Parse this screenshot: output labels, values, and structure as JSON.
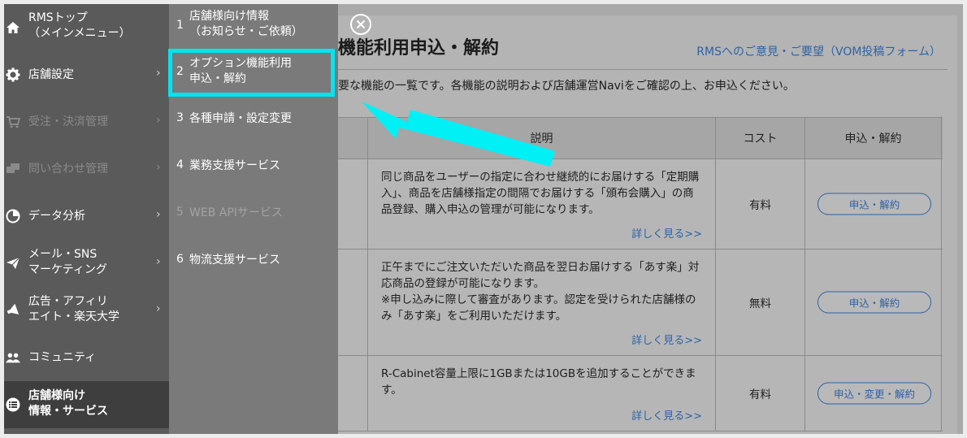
{
  "main": {
    "title": "機能利用申込・解約",
    "feedback_link": "RMSへのご意見・ご要望（VOM投稿フォーム）",
    "intro": "要な機能の一覧です。各機能の説明および店舗運営Naviをご確認の上、お申込ください。",
    "table": {
      "headers": {
        "desc": "説明",
        "cost": "コスト",
        "action": "申込・解約"
      },
      "rows": [
        {
          "desc": "同じ商品をユーザーの指定に合わせ継続的にお届けする「定期購入」、商品を店舗様指定の間隔でお届けする「頒布会購入」の商品登録、購入申込の管理が可能になります。",
          "more": "詳しく見る>>",
          "cost": "有料",
          "action": "申込・解約"
        },
        {
          "desc": "正午までにご注文いただいた商品を翌日お届けする「あす楽」対応商品の登録が可能になります。\n※申し込みに際して審査があります。認定を受けられた店舗様のみ「あす楽」をご利用いただけます。",
          "more": "詳しく見る>>",
          "cost": "無料",
          "action": "申込・解約"
        },
        {
          "desc": "R-Cabinet容量上限に1GBまたは10GBを追加することができます。",
          "more": "詳しく見る>>",
          "cost": "有料",
          "action": "申込・変更・解約"
        }
      ]
    }
  },
  "sidebar": {
    "items": [
      {
        "label": "RMSトップ\n（メインメニュー）",
        "icon": "home-icon"
      },
      {
        "label": "店舗設定",
        "icon": "gear-icon"
      },
      {
        "label": "受注・決済管理",
        "icon": "cart-icon"
      },
      {
        "label": "問い合わせ管理",
        "icon": "chat-icon"
      },
      {
        "label": "データ分析",
        "icon": "pie-chart-icon"
      },
      {
        "label": "メール・SNS\nマーケティング",
        "icon": "paper-plane-icon"
      },
      {
        "label": "広告・アフィリ\nエイト・楽天大学",
        "icon": "megaphone-icon"
      },
      {
        "label": "コミュニティ",
        "icon": "people-icon"
      },
      {
        "label": "店舗様向け\n情報・サービス",
        "icon": "list-icon"
      }
    ]
  },
  "submenu": {
    "items": [
      {
        "num": "1",
        "label": "店舗様向け情報\n（お知らせ・ご依頼）"
      },
      {
        "num": "2",
        "label": "オプション機能利用\n申込・解約"
      },
      {
        "num": "3",
        "label": "各種申請・設定変更"
      },
      {
        "num": "4",
        "label": "業務支援サービス"
      },
      {
        "num": "5",
        "label": "WEB APIサービス"
      },
      {
        "num": "6",
        "label": "物流支援サービス"
      }
    ]
  },
  "colors": {
    "highlight": "#00e4ef",
    "link": "#2e63a6"
  }
}
